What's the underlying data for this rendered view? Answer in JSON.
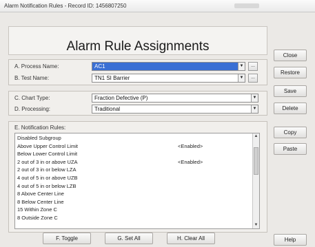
{
  "window": {
    "title": "Alarm Notification Rules - Record ID: 1456807250"
  },
  "header": {
    "title": "Alarm Rule Assignments"
  },
  "fields": {
    "process_name": {
      "label": "A. Process Name:",
      "value": "AC1"
    },
    "test_name": {
      "label": "B. Test Name:",
      "value": "TN1 SI Barrier"
    },
    "chart_type": {
      "label": "C. Chart Type:",
      "value": "Fraction Defective (P)"
    },
    "processing": {
      "label": "D. Processing:",
      "value": "Traditional"
    },
    "ellipsis_label": "..."
  },
  "rules": {
    "label": "E. Notification Rules:",
    "items": [
      {
        "name": "Disabled Subgroup",
        "status": ""
      },
      {
        "name": "Above Upper Control Limit",
        "status": "<Enabled>"
      },
      {
        "name": "Below Lower Control Limit",
        "status": ""
      },
      {
        "name": "2 out of 3 in or above UZA",
        "status": "<Enabled>"
      },
      {
        "name": "2 out of 3 in or below LZA",
        "status": ""
      },
      {
        "name": "4 out of 5 in or above UZB",
        "status": ""
      },
      {
        "name": "4 out of 5 in or below LZB",
        "status": ""
      },
      {
        "name": "8 Above Center Line",
        "status": ""
      },
      {
        "name": "8 Below Center Line",
        "status": ""
      },
      {
        "name": "15 Within Zone C",
        "status": ""
      },
      {
        "name": "8 Outside Zone C",
        "status": ""
      }
    ]
  },
  "buttons": {
    "toggle": "F. Toggle",
    "set_all": "G. Set All",
    "clear_all": "H. Clear All",
    "close": "Close",
    "restore": "Restore",
    "save": "Save",
    "delete": "Delete",
    "copy": "Copy",
    "paste": "Paste",
    "help": "Help"
  },
  "icons": {
    "dropdown": "chevron-down-icon",
    "scroll_up": "arrow-up-icon",
    "scroll_down": "arrow-down-icon"
  }
}
